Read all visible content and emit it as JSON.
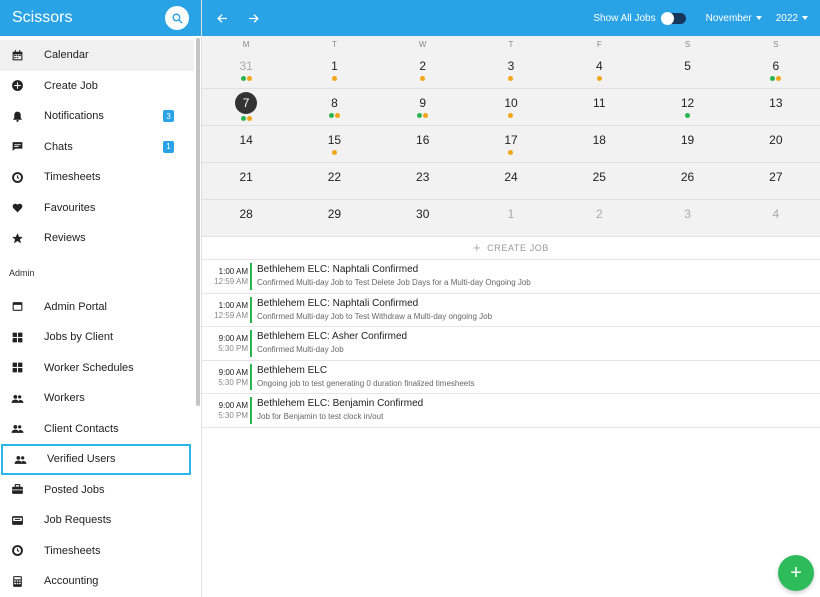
{
  "app": {
    "title": "Scissors"
  },
  "sidebar": {
    "items": [
      {
        "label": "Calendar",
        "icon": "calendar-icon"
      },
      {
        "label": "Create Job",
        "icon": "add-circle-icon"
      },
      {
        "label": "Notifications",
        "icon": "bell-icon",
        "badge": "3"
      },
      {
        "label": "Chats",
        "icon": "chat-icon",
        "badge": "1"
      },
      {
        "label": "Timesheets",
        "icon": "clock-icon"
      },
      {
        "label": "Favourites",
        "icon": "heart-icon"
      },
      {
        "label": "Reviews",
        "icon": "star-icon"
      }
    ],
    "admin_label": "Admin",
    "admin_items": [
      {
        "label": "Admin Portal",
        "icon": "portal-icon"
      },
      {
        "label": "Jobs by Client",
        "icon": "grid-icon"
      },
      {
        "label": "Worker Schedules",
        "icon": "grid-icon"
      },
      {
        "label": "Workers",
        "icon": "people-icon"
      },
      {
        "label": "Client Contacts",
        "icon": "people-icon"
      },
      {
        "label": "Verified Users",
        "icon": "people-icon"
      },
      {
        "label": "Posted Jobs",
        "icon": "briefcase-icon"
      },
      {
        "label": "Job Requests",
        "icon": "inbox-icon"
      },
      {
        "label": "Timesheets",
        "icon": "clock-icon"
      },
      {
        "label": "Accounting",
        "icon": "calculator-icon"
      }
    ]
  },
  "topbar": {
    "show_all_jobs": "Show All Jobs",
    "month": "November",
    "year": "2022"
  },
  "calendar": {
    "weekdays": [
      "M",
      "T",
      "W",
      "T",
      "F",
      "S",
      "S"
    ],
    "weeks": [
      [
        {
          "d": "31",
          "muted": true,
          "dots": [
            "g",
            "o"
          ]
        },
        {
          "d": "1",
          "dots": [
            "o"
          ]
        },
        {
          "d": "2",
          "dots": [
            "o"
          ]
        },
        {
          "d": "3",
          "dots": [
            "o"
          ]
        },
        {
          "d": "4",
          "dots": [
            "o"
          ]
        },
        {
          "d": "5",
          "dots": []
        },
        {
          "d": "6",
          "dots": [
            "g",
            "o"
          ]
        }
      ],
      [
        {
          "d": "7",
          "today": true,
          "dots": [
            "g",
            "o"
          ]
        },
        {
          "d": "8",
          "dots": [
            "g",
            "o"
          ]
        },
        {
          "d": "9",
          "dots": [
            "g",
            "o"
          ]
        },
        {
          "d": "10",
          "dots": [
            "o"
          ]
        },
        {
          "d": "11",
          "dots": []
        },
        {
          "d": "12",
          "dots": [
            "g"
          ]
        },
        {
          "d": "13",
          "dots": []
        }
      ],
      [
        {
          "d": "14",
          "dots": []
        },
        {
          "d": "15",
          "dots": [
            "o"
          ]
        },
        {
          "d": "16",
          "dots": []
        },
        {
          "d": "17",
          "dots": [
            "o"
          ]
        },
        {
          "d": "18",
          "dots": []
        },
        {
          "d": "19",
          "dots": []
        },
        {
          "d": "20",
          "dots": []
        }
      ],
      [
        {
          "d": "21",
          "dots": []
        },
        {
          "d": "22",
          "dots": []
        },
        {
          "d": "23",
          "dots": []
        },
        {
          "d": "24",
          "dots": []
        },
        {
          "d": "25",
          "dots": []
        },
        {
          "d": "26",
          "dots": []
        },
        {
          "d": "27",
          "dots": []
        }
      ],
      [
        {
          "d": "28",
          "dots": []
        },
        {
          "d": "29",
          "dots": []
        },
        {
          "d": "30",
          "dots": []
        },
        {
          "d": "1",
          "muted": true,
          "dots": []
        },
        {
          "d": "2",
          "muted": true,
          "dots": []
        },
        {
          "d": "3",
          "muted": true,
          "dots": []
        },
        {
          "d": "4",
          "muted": true,
          "dots": []
        }
      ]
    ]
  },
  "jobs": {
    "create_label": "CREATE JOB",
    "items": [
      {
        "start": "1:00 AM",
        "end": "12:59 AM",
        "title": "Bethlehem ELC: Naphtali Confirmed",
        "subtitle": "Confirmed Multi-day Job to Test Delete Job Days for a Multi-day Ongoing Job"
      },
      {
        "start": "1:00 AM",
        "end": "12:59 AM",
        "title": "Bethlehem ELC: Naphtali Confirmed",
        "subtitle": "Confirmed Multi-day Job to Test Withdraw a Multi-day ongoing Job"
      },
      {
        "start": "9:00 AM",
        "end": "5:30 PM",
        "title": "Bethlehem ELC: Asher Confirmed",
        "subtitle": "Confirmed Multi-day Job"
      },
      {
        "start": "9:00 AM",
        "end": "5:30 PM",
        "title": "Bethlehem ELC",
        "subtitle": "Ongoing job to test generating 0 duration finalized timesheets"
      },
      {
        "start": "9:00 AM",
        "end": "5:30 PM",
        "title": "Bethlehem ELC: Benjamin Confirmed",
        "subtitle": "Job for Benjamin to test clock in/out"
      }
    ]
  },
  "colors": {
    "accent": "#2aa3e6",
    "dot_green": "#29b54d",
    "dot_orange": "#f3a51a",
    "fab": "#2ebc5a"
  },
  "fab": {
    "label": "+"
  }
}
